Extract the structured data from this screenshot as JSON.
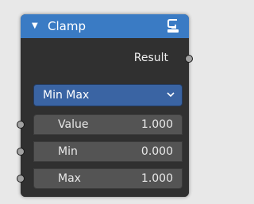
{
  "node": {
    "title": "Clamp",
    "header_color": "#3a7bc4",
    "collapse_icon": "triangle-down",
    "group_icon": "node-group-icon",
    "output": {
      "label": "Result"
    },
    "mode_select": {
      "value": "Min Max",
      "icon": "chevron-down"
    },
    "inputs": [
      {
        "label": "Value",
        "value": "1.000"
      },
      {
        "label": "Min",
        "value": "0.000"
      },
      {
        "label": "Max",
        "value": "1.000"
      }
    ],
    "socket_color": "#a1a1a1"
  }
}
